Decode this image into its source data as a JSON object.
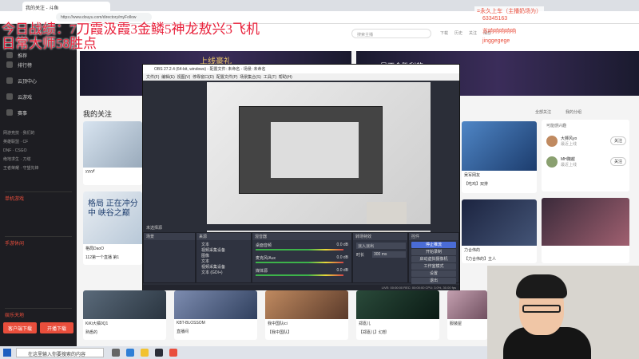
{
  "browser": {
    "tab_title": "我的关注 - 斗鱼",
    "url": "https://www.douyu.com/directory/myFollow",
    "search_placeholder": "搜索主播",
    "nav": [
      "下载",
      "历史",
      "关注",
      "消息"
    ]
  },
  "overlay": {
    "line1": "今日战绩：7刀霞汲霞3金鳞5神龙敖兴3飞机",
    "line2": "日常大师58胜点",
    "fan_badge": "=永久上车（主播奶场为）",
    "fan_line2": "63345163",
    "fan_line3": "苏响响响响响",
    "fan_line4": "jinggegege"
  },
  "sidebar": {
    "items": [
      "推荐",
      "排行榜",
      "云顶中心",
      "云游戏",
      "赛事"
    ],
    "grid_top": [
      "网游竞技",
      "我们的",
      "英雄联盟",
      "CF",
      "DNF",
      "CSGO",
      "绝地求生",
      "刀塔",
      "王者荣耀",
      "守望先锋"
    ],
    "section1": "单机游戏",
    "section2": "手游休闲",
    "section3": "娱乐天地",
    "btn_left": "客户端下载",
    "btn_right": "开播下载"
  },
  "main": {
    "follow_title": "我的关注",
    "follow_tabs": [
      "全部关注",
      "我的分组"
    ],
    "banner_left": "上线豪礼",
    "banner_right": "是不会胜利的",
    "big_tile": "格局 正在冲分中 峡谷之巅",
    "cards": [
      {
        "name": "yyyyf",
        "title": "YF起 三洞之巅"
      },
      {
        "name": "吴军网友",
        "title": "【吃鸡】双排"
      },
      {
        "name": "格局DaoO",
        "title": "112第一个直播 第1"
      },
      {
        "name": "力合伟的",
        "title": "【力合伟的】主人"
      },
      {
        "name": "KiKi大橘0Q1",
        "title": "熟悉的"
      },
      {
        "name": "KBT-BLOSSOM",
        "title": "直播间"
      },
      {
        "name": "我中国队ici",
        "title": "【我中国队】"
      },
      {
        "name": "郑嘉儿",
        "title": "【郑嘉儿】幻想"
      },
      {
        "name": "服装屋",
        "title": "女装"
      }
    ],
    "right_panel_title": "可能感兴趣",
    "right_panel": [
      {
        "name": "大狮风yo",
        "sub": "最近上线",
        "btn": "关注"
      },
      {
        "name": "MH魏越",
        "sub": "最近上线",
        "btn": "关注"
      }
    ]
  },
  "obs": {
    "title": "OBS 27.2.4 (64-bit, windows) - 配置文件: 未命名 - 场景: 未命名",
    "menu": [
      "文件(F)",
      "编辑(E)",
      "视图(V)",
      "停靠窗口(D)",
      "配置文件(P)",
      "场景集合(S)",
      "工具(T)",
      "帮助(H)"
    ],
    "docks": {
      "scenes": "场景",
      "sources": "来源",
      "mixer": "混音器",
      "transitions": "转场特效",
      "controls": "控件"
    },
    "scene_bar_label": "未选择源",
    "sources": [
      "文本",
      "视频采集设备",
      "图像",
      "文本",
      "视频采集设备",
      "文本 (GDI+)"
    ],
    "mixer": [
      {
        "name": "桌面音频",
        "db": "0.0 dB"
      },
      {
        "name": "麦克风/Aux",
        "db": "0.0 dB"
      },
      {
        "name": "媒体源",
        "db": "0.0 dB"
      }
    ],
    "transition": {
      "type": "淡入淡出",
      "duration_label": "时长",
      "duration": "300 ms"
    },
    "controls": [
      "停止推流",
      "开始录制",
      "启动虚拟摄像机",
      "工作室模式",
      "设置",
      "退出"
    ],
    "status": "LIVE: 00:00:00   REC: 00:00:00   CPU: 3.0%, 30.00 fps"
  },
  "taskbar": {
    "search_placeholder": "在这里输入你要搜索的内容"
  },
  "colors": {
    "accent": "#e94e3c",
    "obs_bg": "#2b2e38",
    "sidebar_bg": "#1d1d22",
    "overlay_text": "#e8203a"
  }
}
